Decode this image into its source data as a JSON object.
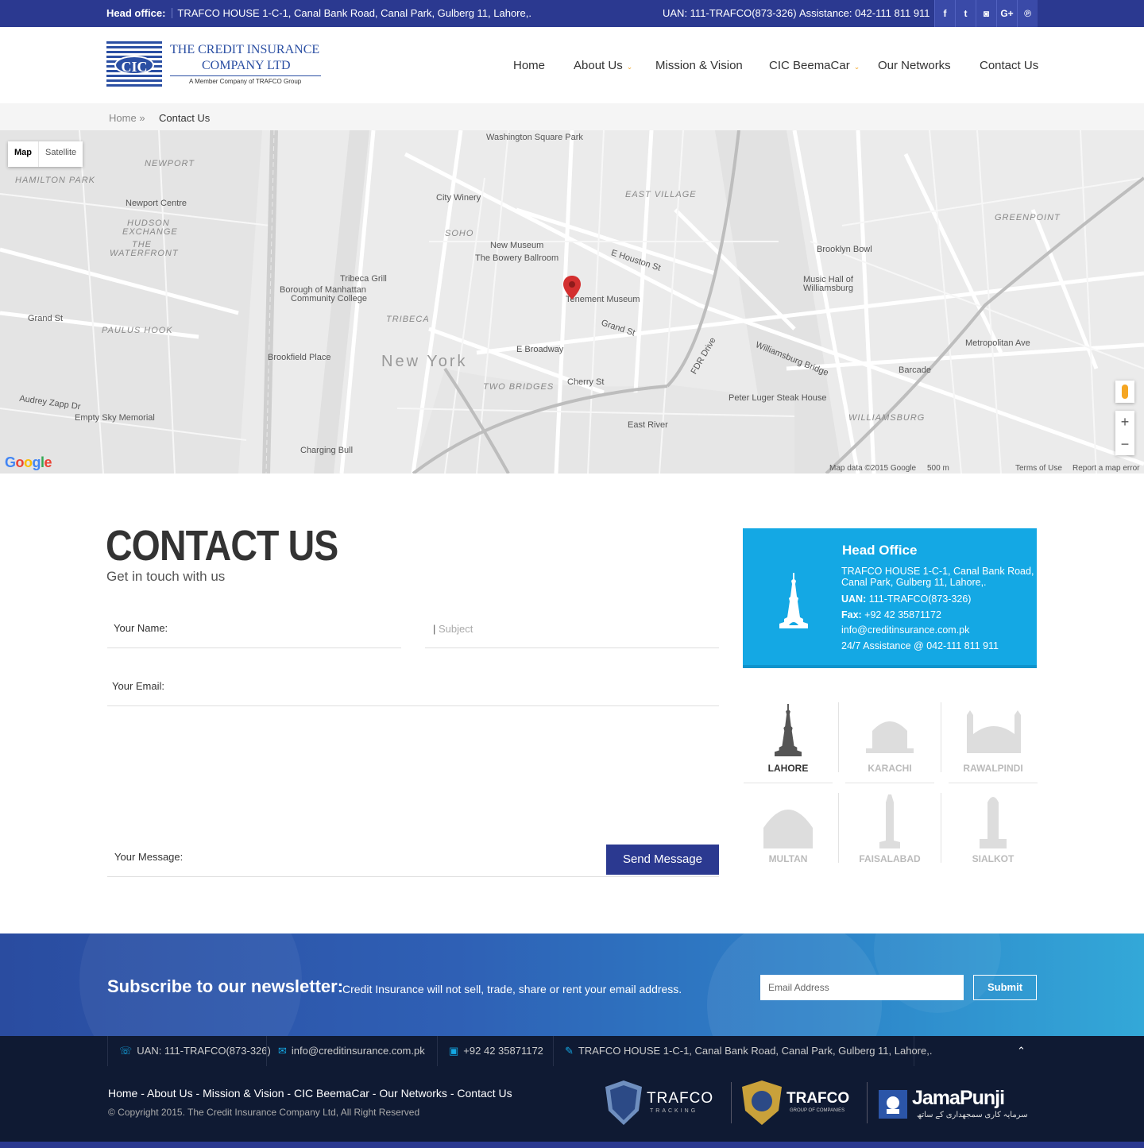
{
  "topbar": {
    "head_office_label": "Head office:",
    "head_office_address": "TRAFCO HOUSE 1-C-1, Canal Bank Road, Canal Park, Gulberg 11, Lahore,.",
    "uan": "UAN: 111-TRAFCO(873-326)",
    "assistance": "Assistance: 042-111 811 911",
    "social": [
      "f",
      "t",
      "◙",
      "G+",
      "℗"
    ]
  },
  "logo": {
    "mark": "CIC",
    "line1": "THE CREDIT INSURANCE",
    "line2": "COMPANY LTD",
    "tagline": "A Member Company of TRAFCO Group"
  },
  "nav": {
    "home": "Home",
    "about": "About Us",
    "mission": "Mission & Vision",
    "beemacar": "CIC BeemaCar",
    "networks": "Our Networks",
    "contact": "Contact Us"
  },
  "breadcrumb": {
    "home": "Home",
    "current": "Contact Us"
  },
  "map": {
    "tab_map": "Map",
    "tab_satellite": "Satellite",
    "city_label": "New York",
    "pin_label": "Tenement Museum",
    "attribution": "Map data ©2015 Google",
    "scale": "500 m",
    "terms": "Terms of Use",
    "report": "Report a map error",
    "google": "Google",
    "zoom_in": "+",
    "zoom_out": "−",
    "labels": [
      "Washington Square Park",
      "City Winery",
      "SOHO",
      "New Museum",
      "The Bowery Ballroom",
      "Tribeca Grill",
      "TRIBECA",
      "Borough of Manhattan",
      "Community College",
      "Brookfield Place",
      "TWO BRIDGES",
      "Cherry St",
      "East River",
      "Charging Bull",
      "Empty Sky Memorial",
      "Newport Centre",
      "HAMILTON PARK",
      "NEWPORT",
      "HUDSON",
      "EXCHANGE",
      "THE",
      "WATERFRONT",
      "PAULUS HOOK",
      "Grand St",
      "EAST VILLAGE",
      "Brooklyn Bowl",
      "Music Hall of",
      "Williamsburg",
      "GREENPOINT",
      "WILLIAMSBURG",
      "Peter Luger Steak House",
      "Barcade",
      "Metropolitan Ave",
      "Williamsburg Bridge",
      "FDR Drive",
      "E Broadway",
      "E Houston St",
      "Grand St",
      "Audrey Zapp Dr"
    ]
  },
  "contact": {
    "title": "CONTACT US",
    "subtitle": "Get in touch with us",
    "name_label": "Your Name:",
    "subject_placeholder": "Subject",
    "email_label": "Your Email:",
    "message_label": "Your Message:",
    "send": "Send Message"
  },
  "head_office": {
    "title": "Head Office",
    "address1": "TRAFCO HOUSE 1-C-1, Canal Bank Road,",
    "address2": "Canal Park, Gulberg 11, Lahore,.",
    "uan_label": "UAN:",
    "uan_value": " 111-TRAFCO(873-326)",
    "fax_label": "Fax:",
    "fax_value": " +92 42 35871172",
    "email": "info@creditinsurance.com.pk",
    "assistance": "24/7 Assistance @ 042-111 811 911"
  },
  "cities": [
    "LAHORE",
    "KARACHI",
    "RAWALPINDI",
    "MULTAN",
    "FAISALABAD",
    "SIALKOT"
  ],
  "newsletter": {
    "title": "Subscribe to our newsletter:",
    "text": "Credit Insurance will not sell, trade, share or rent your email address.",
    "placeholder": "Email Address",
    "submit": "Submit"
  },
  "footer": {
    "uan": "UAN: 111-TRAFCO(873-326)",
    "email": "info@creditinsurance.com.pk",
    "phone": "+92 42 35871172",
    "address": "TRAFCO HOUSE 1-C-1, Canal Bank Road, Canal Park, Gulberg 11, Lahore,.",
    "up": "⌃",
    "links": [
      "Home",
      "About Us",
      "Mission & Vision",
      "CIC BeemaCar",
      "Our Networks",
      "Contact Us"
    ],
    "link_sep": " - ",
    "copyright": "© Copyright 2015. The Credit Insurance Company Ltd, All Right Reserved",
    "logo1_name": "TRAFCO",
    "logo1_sub": "TRACKING",
    "logo2_name": "TRAFCO",
    "logo2_sub": "GROUP OF COMPANIES",
    "logo3_name": "JamaPunji",
    "logo3_sub": "سرمایہ کاری سمجھداری کے ساتھ"
  },
  "colors": {
    "brand_blue": "#2b3990",
    "accent_cyan": "#14a8e4",
    "caret_orange": "#f5a623",
    "pin_red": "#d32f2f"
  }
}
